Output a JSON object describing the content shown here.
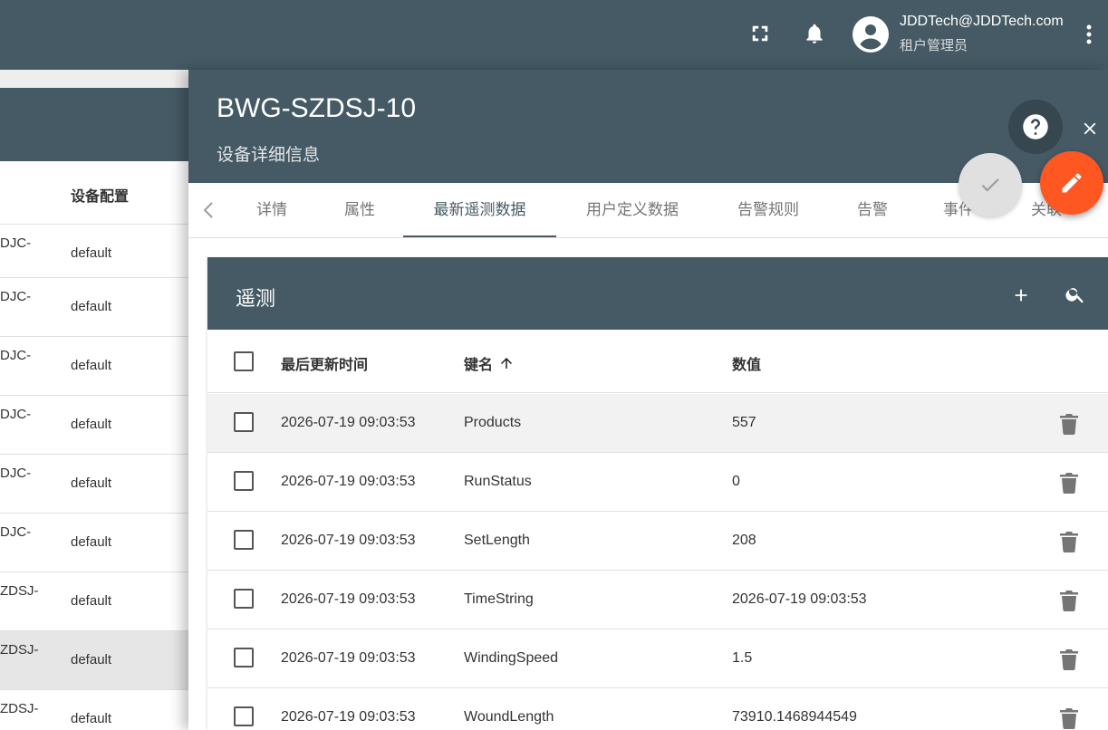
{
  "topbar": {
    "user_email": "JDDTech@JDDTech.com",
    "user_role": "租户管理员",
    "icons": [
      "fullscreen-icon",
      "bell-icon",
      "account-circle-icon",
      "more-vert-icon"
    ]
  },
  "background_list": {
    "column_header": "设备配置",
    "rows": [
      {
        "name": "DJC-",
        "profile": "default"
      },
      {
        "name": "DJC-",
        "profile": "default"
      },
      {
        "name": "DJC-",
        "profile": "default"
      },
      {
        "name": "DJC-",
        "profile": "default"
      },
      {
        "name": "DJC-",
        "profile": "default"
      },
      {
        "name": "DJC-",
        "profile": "default"
      },
      {
        "name": "ZDSJ-",
        "profile": "default"
      },
      {
        "name": "ZDSJ-",
        "profile": "default"
      },
      {
        "name": "ZDSJ-",
        "profile": "default"
      }
    ]
  },
  "panel": {
    "title": "BWG-SZDSJ-10",
    "subtitle": "设备详细信息",
    "accent_color": "#ff5722",
    "header_color": "#455a64"
  },
  "tabs": [
    {
      "label": "详情"
    },
    {
      "label": "属性"
    },
    {
      "label": "最新遥测数据"
    },
    {
      "label": "用户定义数据"
    },
    {
      "label": "告警规则"
    },
    {
      "label": "告警"
    },
    {
      "label": "事件"
    },
    {
      "label": "关联"
    }
  ],
  "active_tab": "最新遥测数据",
  "telemetry": {
    "title": "遥测",
    "columns": {
      "last_update": "最后更新时间",
      "key": "键名",
      "value": "数值"
    },
    "rows": [
      {
        "time": "2026-07-19 09:03:53",
        "key": "Products",
        "value": "557"
      },
      {
        "time": "2026-07-19 09:03:53",
        "key": "RunStatus",
        "value": "0"
      },
      {
        "time": "2026-07-19 09:03:53",
        "key": "SetLength",
        "value": "208"
      },
      {
        "time": "2026-07-19 09:03:53",
        "key": "TimeString",
        "value": "2026-07-19 09:03:53"
      },
      {
        "time": "2026-07-19 09:03:53",
        "key": "WindingSpeed",
        "value": "1.5"
      },
      {
        "time": "2026-07-19 09:03:53",
        "key": "WoundLength",
        "value": "73910.1468944549"
      }
    ]
  }
}
